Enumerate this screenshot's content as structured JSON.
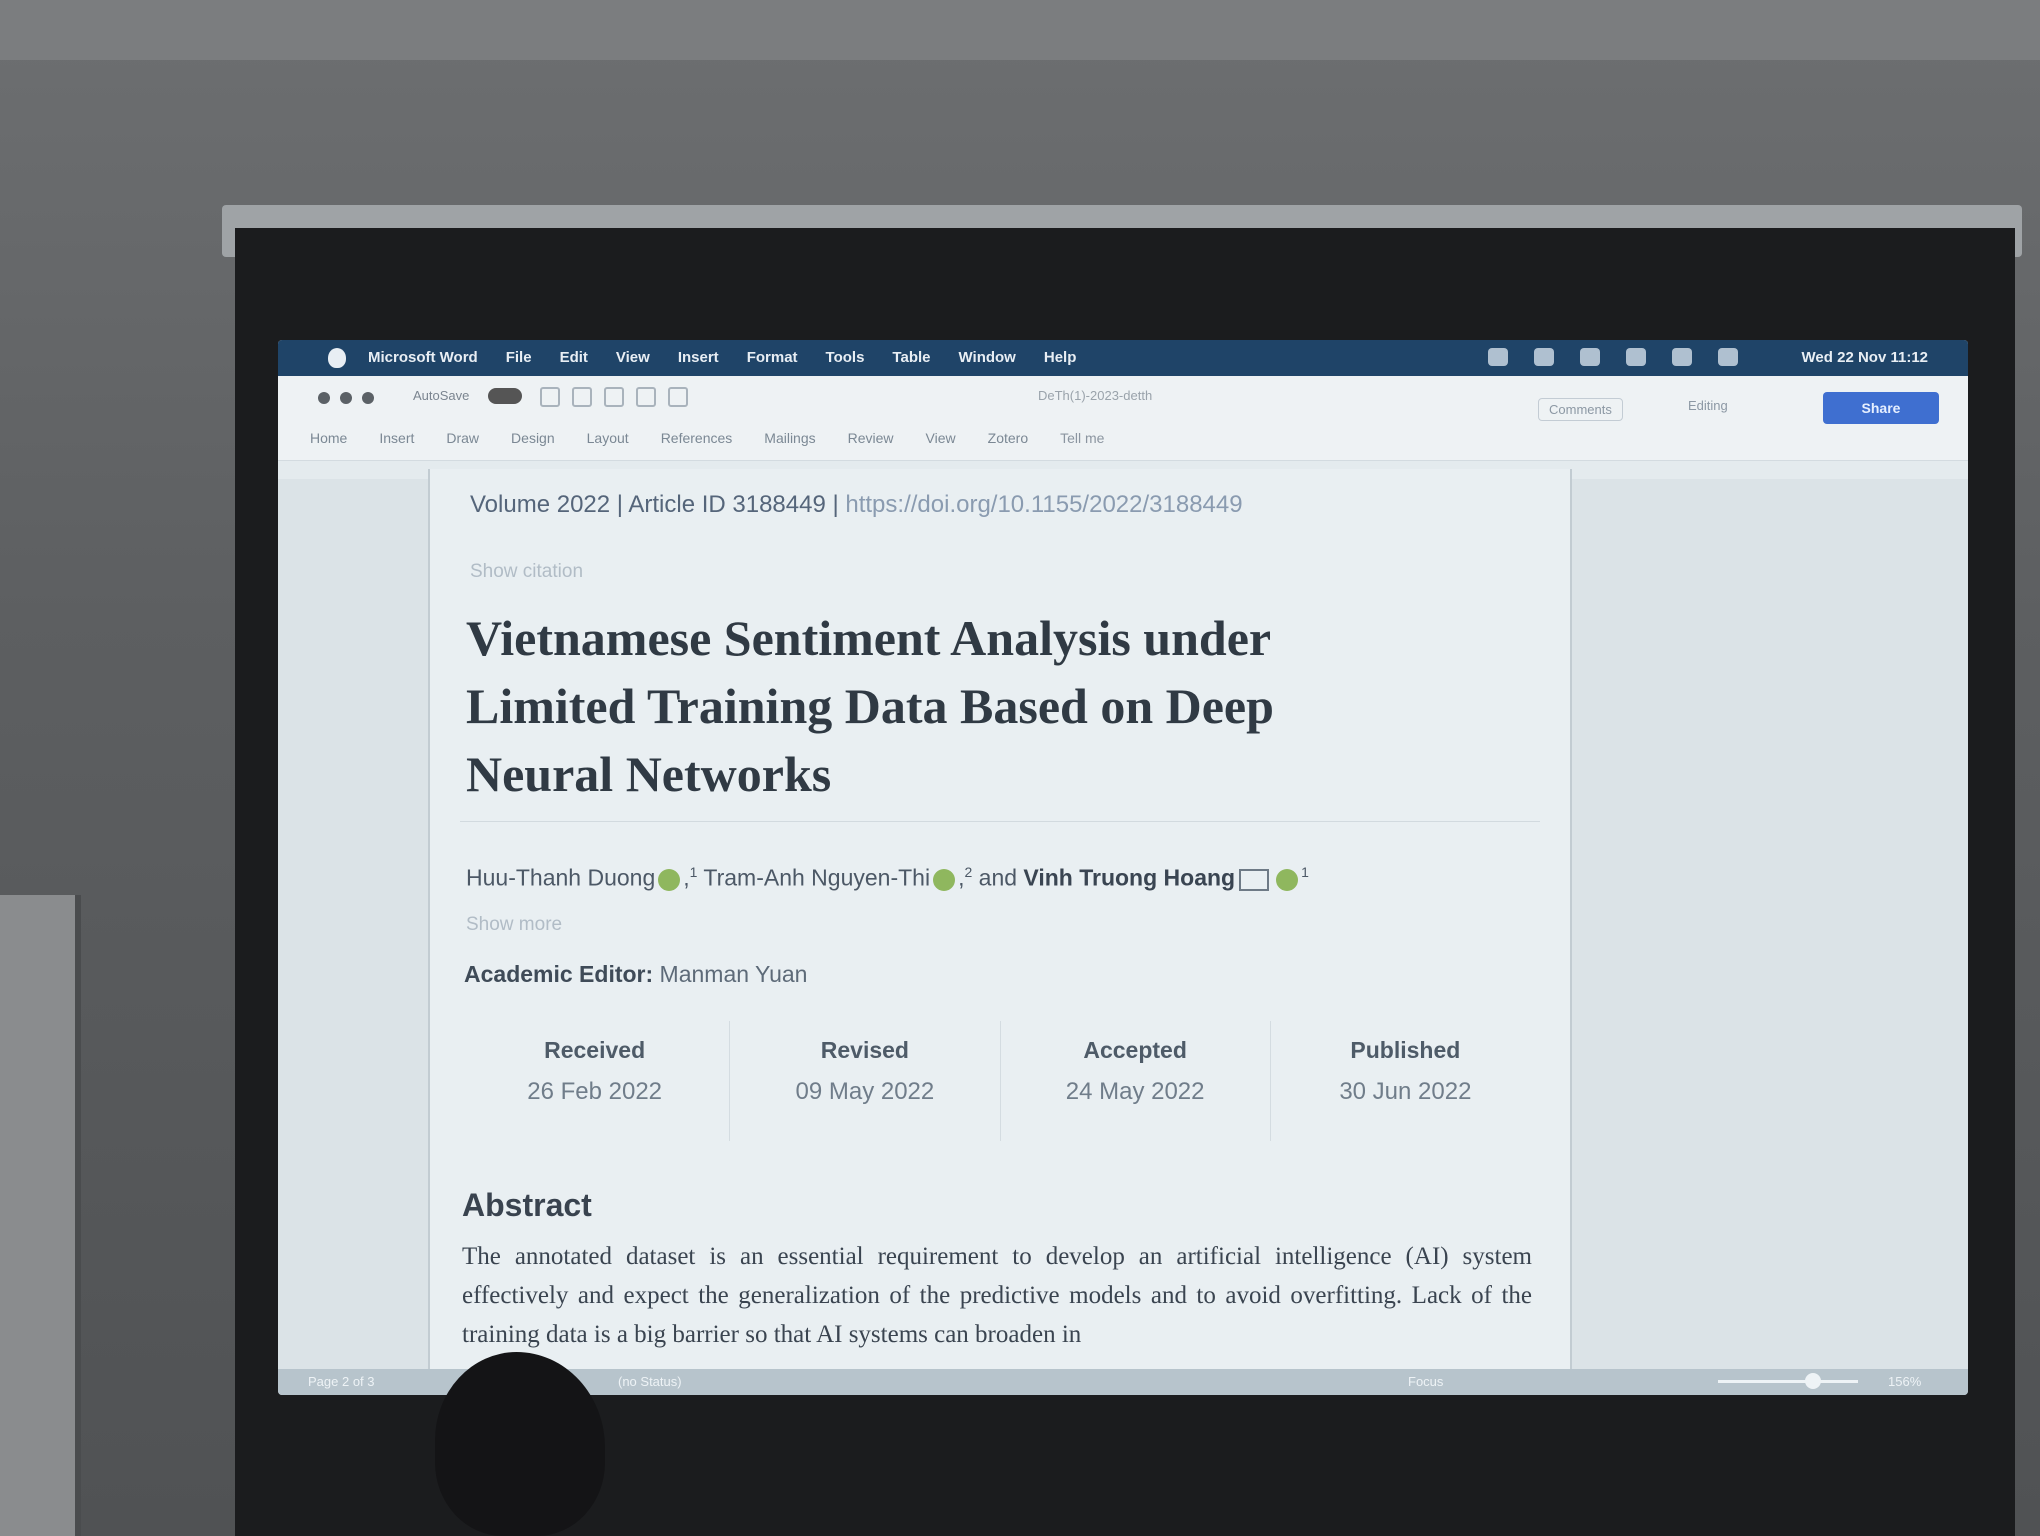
{
  "menubar": {
    "app": "Microsoft Word",
    "menus": [
      "File",
      "Edit",
      "View",
      "Insert",
      "Format",
      "Tools",
      "Table",
      "Window",
      "Help"
    ],
    "clock": "Wed 22 Nov 11:12"
  },
  "window": {
    "autosave": "AutoSave",
    "doc_name": "DeTh(1)-2023-detth"
  },
  "ribbon": {
    "tabs": [
      "Home",
      "Insert",
      "Draw",
      "Design",
      "Layout",
      "References",
      "Mailings",
      "Review",
      "View",
      "Zotero",
      "Tell me"
    ],
    "comments": "Comments",
    "editing": "Editing",
    "share": "Share"
  },
  "document": {
    "volume": "Volume 2022 | Article ID 3188449 | ",
    "doi": "https://doi.org/10.1155/2022/3188449",
    "show_citation": "Show citation",
    "title": "Vietnamese Sentiment Analysis under Limited Training Data Based on Deep Neural Networks",
    "authors": {
      "a1": "Huu-Thanh Duong",
      "a1_sup": "1",
      "a2": "Tram-Anh Nguyen-Thi",
      "a2_sup": "2",
      "and": "and",
      "a3": "Vinh Truong Hoang",
      "a3_sup": "1"
    },
    "show_more": "Show more",
    "editor_label": "Academic Editor:",
    "editor_name": "Manman Yuan",
    "dates": [
      {
        "label": "Received",
        "value": "26 Feb 2022"
      },
      {
        "label": "Revised",
        "value": "09 May 2022"
      },
      {
        "label": "Accepted",
        "value": "24 May 2022"
      },
      {
        "label": "Published",
        "value": "30 Jun 2022"
      }
    ],
    "abstract_heading": "Abstract",
    "abstract_text": "The annotated dataset is an essential requirement to develop an artificial intelligence (AI) system effectively and expect the generalization of the predictive models and to avoid overfitting. Lack of the training data is a big barrier so that AI systems can broaden in"
  },
  "statusbar": {
    "page": "Page 2 of 3",
    "language": "(no Status)",
    "focus": "Focus",
    "zoom": "156%"
  }
}
